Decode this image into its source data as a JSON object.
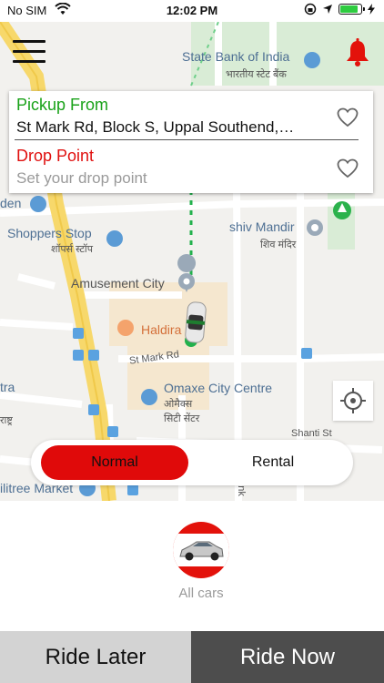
{
  "status_bar": {
    "carrier": "No SIM",
    "time": "12:02 PM",
    "battery_level": 0.85
  },
  "map": {
    "labels": {
      "state_bank_en": "State Bank of India",
      "state_bank_hi": "भारतीय स्टेट बैंक",
      "garden": "den",
      "shiv_mandir_en": "shiv Mandir",
      "shiv_mandir_hi": "शिव मंदिर",
      "shoppers_stop_en": "Shoppers Stop",
      "shoppers_stop_hi": "शॉपर्स स्टॉप",
      "amusement_city": "Amusement City",
      "haldiram": "Haldira",
      "st_mark_rd": "St Mark Rd",
      "omaxe_en": "Omaxe City Centre",
      "omaxe_hi_1": "ओमैक्स",
      "omaxe_hi_2": "सिटी सेंटर",
      "tra": "tra",
      "rashtra": "राष्ट्र",
      "shanti": "Shanti St",
      "ilitree": "ilitree Market",
      "ank": "ank"
    }
  },
  "location_card": {
    "pickup_label": "Pickup From",
    "pickup_value": "St Mark Rd, Block S, Uppal Southend,…",
    "drop_label": "Drop Point",
    "drop_placeholder": "Set your drop point",
    "pickup_label_color": "#19a219",
    "drop_label_color": "#e0100f"
  },
  "mode_toggle": {
    "normal_label": "Normal",
    "rental_label": "Rental",
    "selected": "Normal",
    "active_color": "#e00a0a"
  },
  "car_options": [
    {
      "label": "All cars"
    }
  ],
  "actions": {
    "ride_later": "Ride Later",
    "ride_now": "Ride Now"
  },
  "icons": [
    "wifi-icon",
    "location-arrow-icon",
    "battery-icon",
    "menu-icon",
    "bell-icon",
    "heart-icon",
    "gps-target-icon",
    "car-icon"
  ]
}
